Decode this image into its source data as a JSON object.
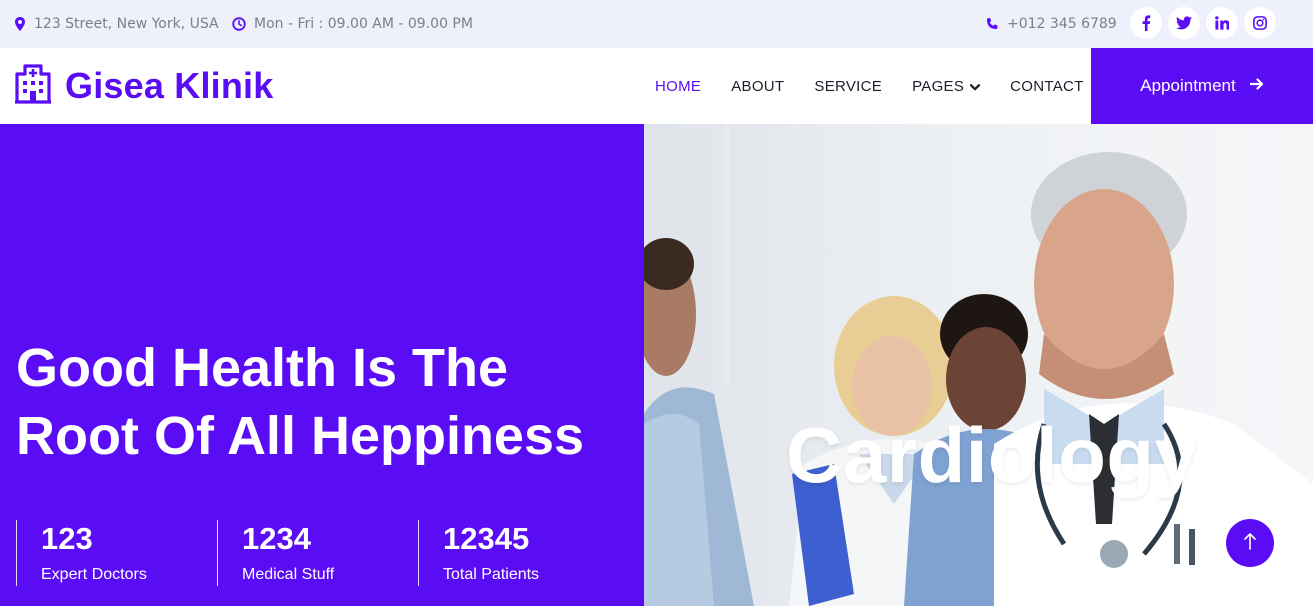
{
  "topbar": {
    "address": "123 Street, New York, USA",
    "hours": "Mon - Fri : 09.00 AM - 09.00 PM",
    "phone": "+012 345 6789",
    "socials": [
      {
        "icon": "facebook-icon",
        "glyph": "f"
      },
      {
        "icon": "twitter-icon",
        "glyph": "t"
      },
      {
        "icon": "linkedin-icon",
        "glyph": "in"
      },
      {
        "icon": "instagram-icon",
        "glyph": "ig"
      }
    ]
  },
  "navbar": {
    "brand": "Gisea Klinik",
    "brand_icon": "hospital-icon",
    "menu": [
      {
        "label": "HOME",
        "active": true
      },
      {
        "label": "ABOUT",
        "active": false
      },
      {
        "label": "SERVICE",
        "active": false
      },
      {
        "label": "PAGES",
        "active": false,
        "dropdown": true
      },
      {
        "label": "CONTACT",
        "active": false
      }
    ],
    "appointment_label": "Appointment"
  },
  "hero": {
    "title_line1": "Good Health Is The",
    "title_line2": "Root Of All Heppiness",
    "stats": [
      {
        "number": "123",
        "label": "Expert Doctors"
      },
      {
        "number": "1234",
        "label": "Medical Stuff"
      },
      {
        "number": "12345",
        "label": "Total Patients"
      }
    ],
    "slide_title": "Cardiology"
  },
  "colors": {
    "accent": "#5a0df5",
    "topbar_bg": "#eef0fb",
    "muted_text": "#7b7f8c"
  }
}
